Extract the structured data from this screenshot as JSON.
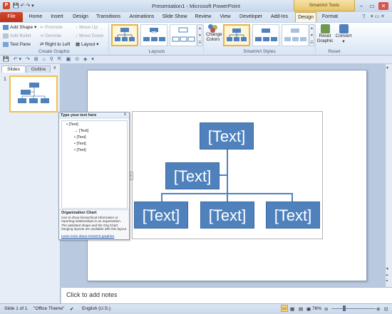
{
  "window": {
    "title": "Presentation1  -  Microsoft PowerPoint",
    "contextual_group": "SmartArt Tools",
    "minimize": "–",
    "maximize": "▭",
    "close": "✕"
  },
  "tabs": [
    "File",
    "Home",
    "Insert",
    "Design",
    "Transitions",
    "Animations",
    "Slide Show",
    "Review",
    "View",
    "Developer",
    "Add-Ins"
  ],
  "contextual_tabs": [
    "Design",
    "Format"
  ],
  "ribbon": {
    "create_graphic": {
      "label": "Create Graphic",
      "add_shape": "Add Shape",
      "add_bullet": "Add Bullet",
      "text_pane": "Text Pane",
      "promote": "Promote",
      "demote": "Demote",
      "right_to_left": "Right to Left",
      "move_up": "Move Up",
      "move_down": "Move Down",
      "layout": "Layout"
    },
    "layouts": {
      "label": "Layouts"
    },
    "smartart_styles": {
      "label": "SmartArt Styles",
      "change_colors_1": "Change",
      "change_colors_2": "Colors"
    },
    "reset": {
      "label": "Reset",
      "reset_graphic_1": "Reset",
      "reset_graphic_2": "Graphic",
      "convert": "Convert"
    }
  },
  "panes": {
    "slides_tab": "Slides",
    "outline_tab": "Outline",
    "close": "x",
    "slide_number": "1"
  },
  "text_pane": {
    "title": "Type your text here",
    "close": "x",
    "items": [
      "[Text]",
      "[Text]",
      "[Text]",
      "[Text]",
      "[Text]"
    ],
    "info_title": "Organization Chart",
    "info_desc": "Use to show hierarchical information or reporting relationships in an organization. The assistant shape and the Org Chart hanging layouts are available with this layout.",
    "info_link": "Learn more about SmartArt graphics"
  },
  "smartart": {
    "top": "[Text]",
    "assistant": "[Text]",
    "children": [
      "[Text]",
      "[Text]",
      "[Text]"
    ]
  },
  "notes": {
    "placeholder": "Click to add notes"
  },
  "status": {
    "slide": "Slide 1 of 1",
    "theme": "\"Office Theme\"",
    "language": "English (U.S.)",
    "zoom": "76%"
  },
  "colors": {
    "accent": "#4f81bd",
    "file_tab": "#c83c22",
    "contextual": "#e8c66a"
  }
}
